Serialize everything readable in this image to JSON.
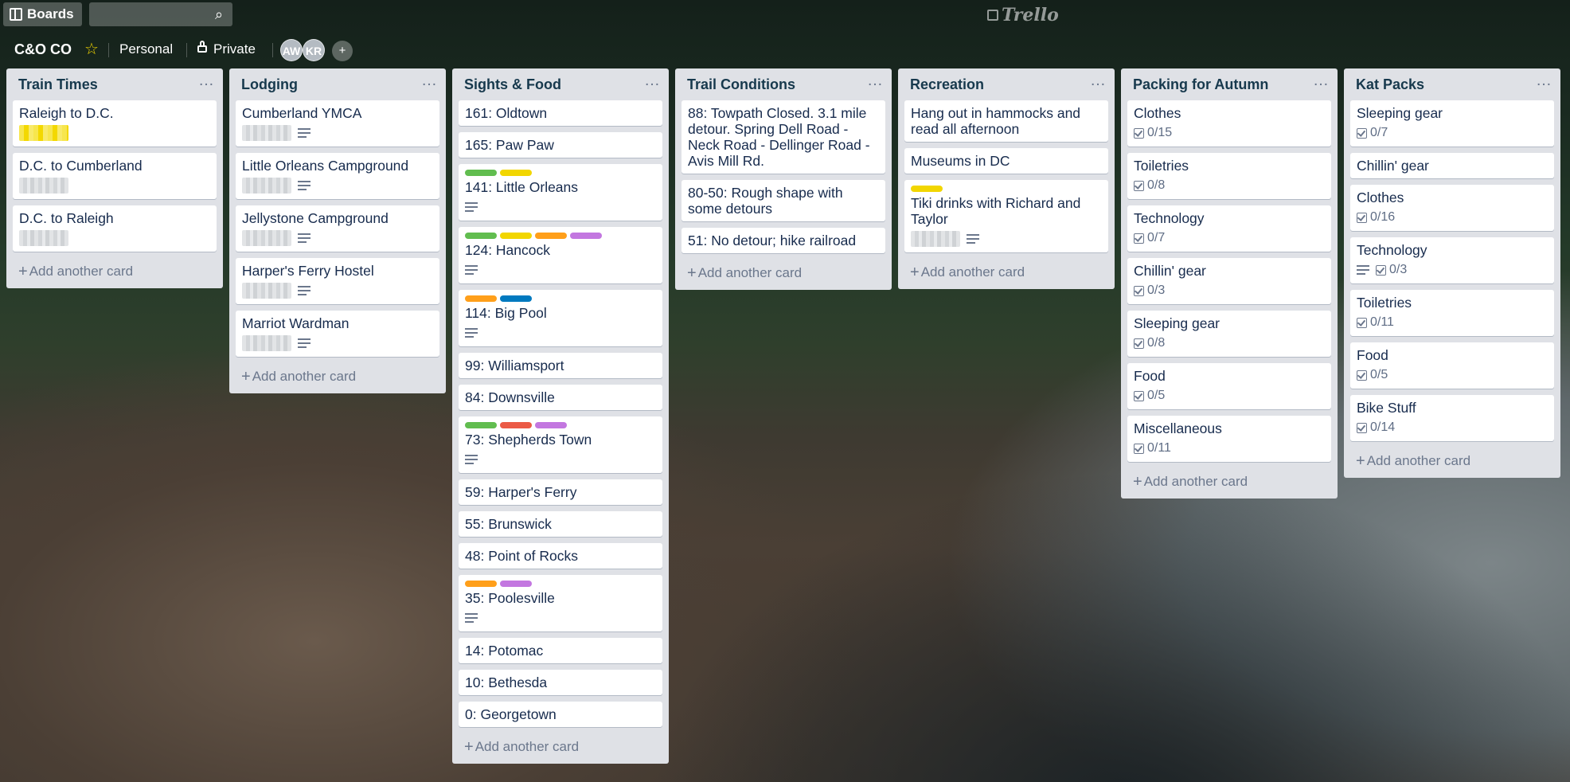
{
  "topbar": {
    "boards_label": "Boards",
    "search": {
      "value": "",
      "placeholder": ""
    },
    "logo_text": "Trello"
  },
  "board": {
    "title": "C&O CO",
    "team": "Personal",
    "visibility": "Private",
    "members": [
      "AW",
      "KR"
    ]
  },
  "colors": {
    "green": "#61bd4f",
    "yellow": "#f2d600",
    "orange": "#ff9f1a",
    "red": "#eb5a46",
    "purple": "#c377e0",
    "blue": "#0079bf"
  },
  "lists": [
    {
      "title": "Train Times",
      "add_label": "Add another card",
      "cards": [
        {
          "title": "Raleigh to D.C.",
          "blur": "yellow"
        },
        {
          "title": "D.C. to Cumberland",
          "blur": "gray"
        },
        {
          "title": "D.C. to Raleigh",
          "blur": "gray"
        }
      ]
    },
    {
      "title": "Lodging",
      "add_label": "Add another card",
      "cards": [
        {
          "title": "Cumberland YMCA",
          "blur": "gray",
          "desc": true
        },
        {
          "title": "Little Orleans Campground",
          "blur": "gray",
          "desc": true
        },
        {
          "title": "Jellystone Campground",
          "blur": "gray",
          "desc": true
        },
        {
          "title": "Harper's Ferry Hostel",
          "blur": "gray",
          "desc": true
        },
        {
          "title": "Marriot Wardman",
          "blur": "gray",
          "desc": true
        }
      ]
    },
    {
      "title": "Sights & Food",
      "add_label": "Add another card",
      "cards": [
        {
          "title": "161: Oldtown"
        },
        {
          "title": "165: Paw Paw"
        },
        {
          "title": "141: Little Orleans",
          "labels": [
            "green",
            "yellow"
          ],
          "desc": true
        },
        {
          "title": "124: Hancock",
          "labels": [
            "green",
            "yellow",
            "orange",
            "purple"
          ],
          "desc": true
        },
        {
          "title": "114: Big Pool",
          "labels": [
            "orange",
            "blue"
          ],
          "desc": true
        },
        {
          "title": "99: Williamsport"
        },
        {
          "title": "84: Downsville"
        },
        {
          "title": "73: Shepherds Town",
          "labels": [
            "green",
            "red",
            "purple"
          ],
          "desc": true
        },
        {
          "title": "59: Harper's Ferry"
        },
        {
          "title": "55: Brunswick"
        },
        {
          "title": "48: Point of Rocks"
        },
        {
          "title": "35: Poolesville",
          "labels": [
            "orange",
            "purple"
          ],
          "desc": true
        },
        {
          "title": "14: Potomac"
        },
        {
          "title": "10: Bethesda"
        },
        {
          "title": "0: Georgetown"
        }
      ]
    },
    {
      "title": "Trail Conditions",
      "add_label": "Add another card",
      "cards": [
        {
          "title": "88: Towpath Closed. 3.1 mile detour. Spring Dell Road - Neck Road - Dellinger Road - Avis Mill Rd."
        },
        {
          "title": "80-50: Rough shape with some detours"
        },
        {
          "title": "51: No detour; hike railroad"
        }
      ]
    },
    {
      "title": "Recreation",
      "add_label": "Add another card",
      "cards": [
        {
          "title": "Hang out in hammocks and read all afternoon"
        },
        {
          "title": "Museums in DC"
        },
        {
          "title": "Tiki drinks with Richard and Taylor",
          "labels": [
            "yellow"
          ],
          "blur": "gray",
          "desc": true
        }
      ]
    },
    {
      "title": "Packing for Autumn",
      "add_label": "Add another card",
      "cards": [
        {
          "title": "Clothes",
          "check": "0/15"
        },
        {
          "title": "Toiletries",
          "check": "0/8"
        },
        {
          "title": "Technology",
          "check": "0/7"
        },
        {
          "title": "Chillin' gear",
          "check": "0/3"
        },
        {
          "title": "Sleeping gear",
          "check": "0/8"
        },
        {
          "title": "Food",
          "check": "0/5"
        },
        {
          "title": "Miscellaneous",
          "check": "0/11"
        }
      ]
    },
    {
      "title": "Kat Packs",
      "add_label": "Add another card",
      "cards": [
        {
          "title": "Sleeping gear",
          "check": "0/7"
        },
        {
          "title": "Chillin' gear"
        },
        {
          "title": "Clothes",
          "check": "0/16"
        },
        {
          "title": "Technology",
          "check": "0/3",
          "desc": true
        },
        {
          "title": "Toiletries",
          "check": "0/11"
        },
        {
          "title": "Food",
          "check": "0/5"
        },
        {
          "title": "Bike Stuff",
          "check": "0/14"
        }
      ]
    }
  ]
}
